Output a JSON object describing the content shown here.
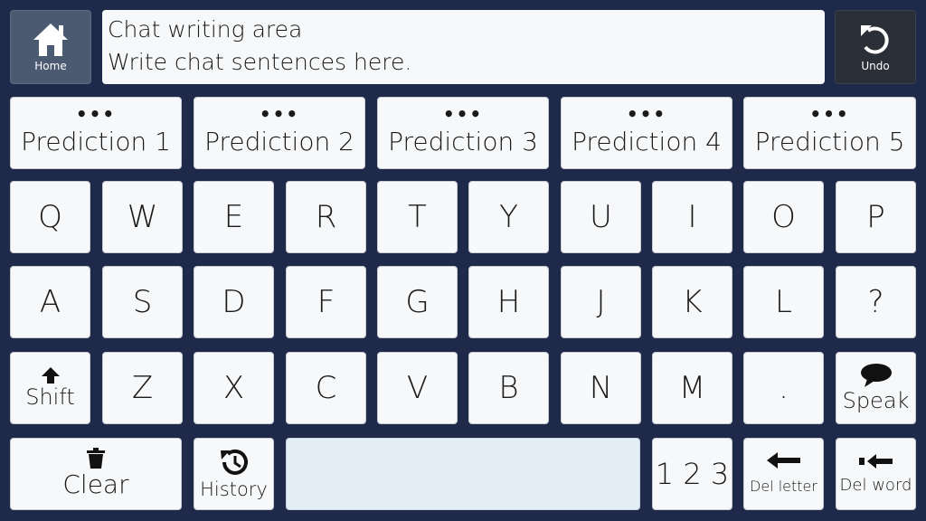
{
  "top": {
    "home_label": "Home",
    "undo_label": "Undo",
    "chat_title": "Chat writing area",
    "chat_text": "Write chat sentences here."
  },
  "predictions": [
    {
      "dots": "•••",
      "label": "Prediction 1"
    },
    {
      "dots": "•••",
      "label": "Prediction 2"
    },
    {
      "dots": "•••",
      "label": "Prediction 3"
    },
    {
      "dots": "•••",
      "label": "Prediction 4"
    },
    {
      "dots": "•••",
      "label": "Prediction 5"
    }
  ],
  "rows": {
    "row1": [
      "Q",
      "W",
      "E",
      "R",
      "T",
      "Y",
      "U",
      "I",
      "O",
      "P"
    ],
    "row2": [
      "A",
      "S",
      "D",
      "F",
      "G",
      "H",
      "J",
      "K",
      "L",
      "?"
    ],
    "row3": [
      "Z",
      "X",
      "C",
      "V",
      "B",
      "N",
      "M",
      "."
    ]
  },
  "special": {
    "shift_label": "Shift",
    "speak_label": "Speak",
    "clear_label": "Clear",
    "history_label": "History",
    "numbers_label": "1 2 3",
    "del_letter_label": "Del letter",
    "del_word_label": "Del word"
  },
  "colors": {
    "background": "#1f2a4a",
    "key": "#f7f8f9",
    "space": "#e3edf6",
    "home_button": "#4b5a70",
    "undo_button": "#2b2f38"
  },
  "icons": {
    "home": "home-icon",
    "undo": "undo-icon",
    "shift": "arrow-up-icon",
    "speak": "speech-bubble-icon",
    "clear": "trash-icon",
    "history": "history-clock-icon",
    "del_letter": "arrow-left-icon",
    "del_word": "arrow-left-bar-icon"
  }
}
